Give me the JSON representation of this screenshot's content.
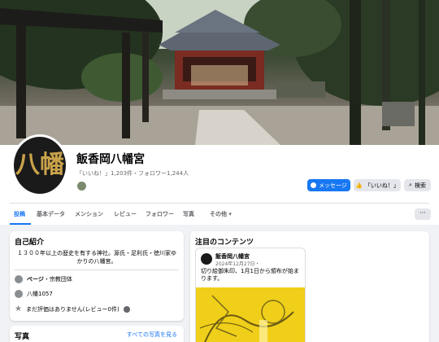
{
  "profile": {
    "name": "飯香岡八幡宮",
    "stats": "「いいね！」1,203件・フォロワー1,244人",
    "crest_text": "八幡"
  },
  "actions": {
    "message_label": "メッセージ",
    "like_label": "「いいね！」",
    "search_label": "検索"
  },
  "tabs": [
    {
      "label": "投稿"
    },
    {
      "label": "基本データ"
    },
    {
      "label": "メンション"
    },
    {
      "label": "レビュー"
    },
    {
      "label": "フォロワー"
    },
    {
      "label": "写真"
    },
    {
      "label": "その他 ▾"
    }
  ],
  "more_label": "···",
  "intro": {
    "title": "自己紹介",
    "text": "１３００年以上の歴史を有する神社。源氏・足利氏・徳川家ゆかりの八幡宮。",
    "page_type_label": "ページ",
    "page_type_value": "・宗教団体",
    "address": "八幡1057",
    "rating": "まだ評価はありません(レビュー0件)"
  },
  "photos": {
    "title": "写真",
    "see_all": "すべての写真を見る"
  },
  "featured": {
    "title": "注目のコンテンツ",
    "post_author": "飯香岡八幡宮",
    "post_date": "2024年12月27日・",
    "post_text": "切り絵御朱印、1月1日から頒布が始まります。"
  },
  "colors": {
    "accent": "#1877f2",
    "background": "#f0f2f5"
  }
}
